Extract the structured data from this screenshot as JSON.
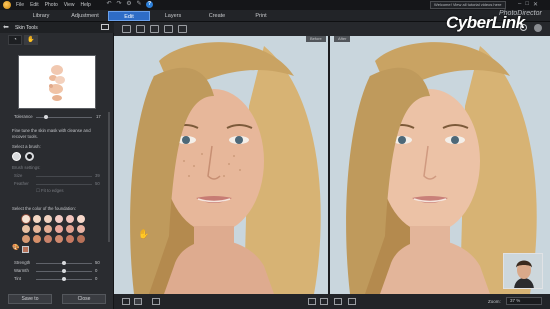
{
  "menu": [
    "File",
    "Edit",
    "Photo",
    "View",
    "Help"
  ],
  "notice": "Welcome! View all tutorial videos here",
  "tabs": [
    "Library",
    "Adjustment",
    "Edit",
    "Layers",
    "Create",
    "Print"
  ],
  "active_tab": "Edit",
  "brand": "CyberLink",
  "product": "PhotoDirector",
  "panel": {
    "title": "Skin Tools",
    "tolerance_label": "Tolerance",
    "tolerance_value": "17",
    "instruction": "Fine tune the skin mask with cleanse and recover tools.",
    "brush_label": "Select a brush:",
    "brush_settings": "Brush settings:",
    "size_label": "Size",
    "size_value": "39",
    "feather_label": "Feather",
    "feather_value": "50",
    "fit_edges": "Fit to edges",
    "color_label": "Select the color of the foundation:",
    "strength_label": "Strength",
    "strength_value": "50",
    "warmth_label": "Warmth",
    "warmth_value": "0",
    "tint_label": "Tint",
    "tint_value": "0",
    "save_label": "Save to",
    "close_label": "Close"
  },
  "view": {
    "before": "Before",
    "after": "After"
  },
  "zoom": {
    "label": "Zoom:",
    "value": "37 %"
  },
  "colors": {
    "accent": "#2e6cc6",
    "swatches": [
      "#f6e3d3",
      "#f4d8c4",
      "#f1d2c0",
      "#f3cbc4",
      "#f2c4bc",
      "#f7d9cb",
      "#e8c2a4",
      "#e6b79b",
      "#e5ae95",
      "#eba79b",
      "#e2a190",
      "#e9b4a5",
      "#d89a73",
      "#d58f69",
      "#c9826a",
      "#d0896e",
      "#c87a62",
      "#b77158"
    ]
  }
}
